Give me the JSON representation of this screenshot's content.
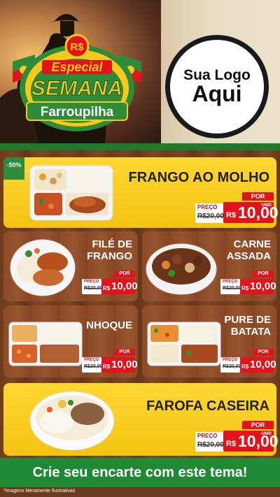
{
  "header": {
    "seal": {
      "currency": "R$",
      "line1": "Especial",
      "line2": "SEMANA",
      "line3": "Farroupilha"
    },
    "logo": {
      "line1": "Sua Logo",
      "line2": "Aqui"
    }
  },
  "products": [
    {
      "title": "FRANGO AO MOLHO",
      "badge": "-50%",
      "por": "POR",
      "preco": "PREÇO",
      "old_price": "R$20,00",
      "currency": "R$",
      "value": "10,00",
      "unit": "UNID"
    },
    {
      "title_l1": "FILÉ DE",
      "title_l2": "FRANGO",
      "por": "POR",
      "preco": "PREÇO",
      "old_price": "R$20,00",
      "currency": "R$",
      "value": "10,00",
      "unit": "UNID"
    },
    {
      "title_l1": "CARNE",
      "title_l2": "ASSADA",
      "por": "POR",
      "preco": "PREÇO",
      "old_price": "R$20,00",
      "currency": "R$",
      "value": "10,00",
      "unit": "UNID"
    },
    {
      "title_l1": "NHOQUE",
      "por": "POR",
      "preco": "PREÇO",
      "old_price": "R$20,00",
      "currency": "R$",
      "value": "10,00",
      "unit": "UNID"
    },
    {
      "title_l1": "PURE DE",
      "title_l2": "BATATA",
      "por": "POR",
      "preco": "PREÇO",
      "old_price": "R$20,00",
      "currency": "R$",
      "value": "10,00",
      "unit": "UNID"
    },
    {
      "title": "FAROFA CASEIRA",
      "por": "POR",
      "preco": "PREÇO",
      "old_price": "R$20,00",
      "currency": "R$",
      "value": "10,00",
      "unit": "UNID"
    }
  ],
  "cta": "Crie seu encarte com este tema!",
  "footnote": "*Imagens Meramente Ilustrativas",
  "colors": {
    "green": "#1f8a33",
    "yellow": "#f7c91a",
    "red": "#e3131b",
    "wood": "#7a4524"
  }
}
